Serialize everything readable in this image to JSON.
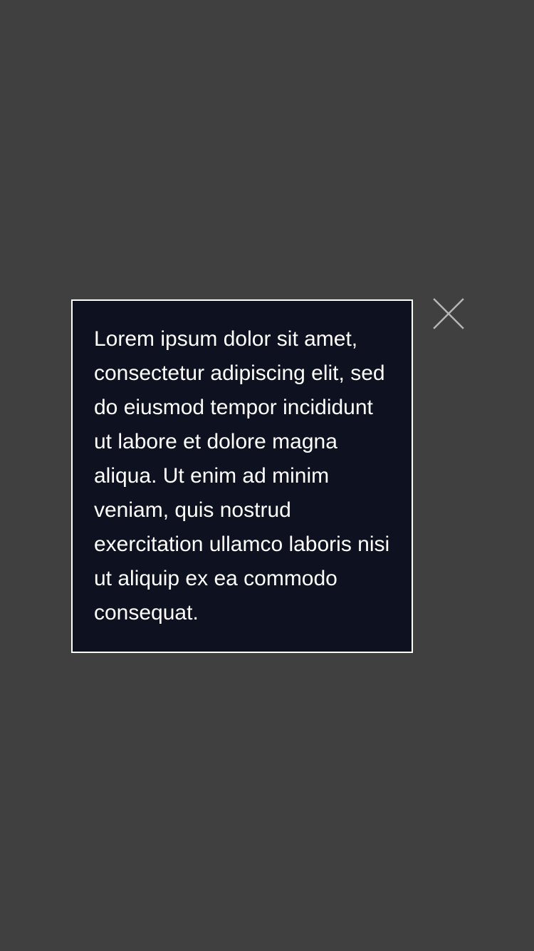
{
  "overlay": {
    "background_color": "#404040"
  },
  "dialog": {
    "background_color": "#0e1220",
    "border_color": "#ffffff",
    "body_text": "Lorem ipsum dolor sit amet, consectetur adipiscing elit, sed do eiusmod tempor incididunt ut labore et dolore magna aliqua. Ut enim ad minim veniam, quis nostrud exercitation ullamco laboris nisi ut aliquip ex ea commodo consequat."
  },
  "close_button": {
    "icon": "close-icon",
    "color": "#b5b5b5"
  }
}
